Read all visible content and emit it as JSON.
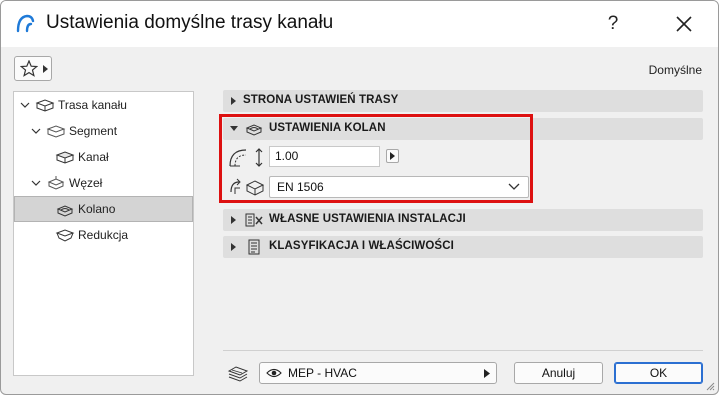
{
  "window": {
    "title": "Ustawienia domyślne trasy kanału",
    "help_label": "?"
  },
  "toolbar": {
    "preset_label": "Domyślne"
  },
  "tree": {
    "items": [
      {
        "label": "Trasa kanału",
        "icon": "duct-route-icon"
      },
      {
        "label": "Segment",
        "icon": "segment-icon"
      },
      {
        "label": "Kanał",
        "icon": "duct-icon"
      },
      {
        "label": "Węzeł",
        "icon": "node-icon"
      },
      {
        "label": "Kolano",
        "icon": "elbow-icon",
        "selected": true
      },
      {
        "label": "Redukcja",
        "icon": "reducer-icon"
      }
    ]
  },
  "panels": {
    "route_settings": {
      "label": "STRONA USTAWIEŃ TRASY",
      "expanded": false
    },
    "elbow_settings": {
      "label": "USTAWIENIA KOLAN",
      "expanded": true,
      "radius_value": "1.00",
      "standard_value": "EN 1506"
    },
    "custom_settings": {
      "label": "WŁASNE USTAWIENIA INSTALACJI",
      "expanded": false
    },
    "classification": {
      "label": "KLASYFIKACJA I WŁAŚCIWOŚCI",
      "expanded": false
    }
  },
  "footer": {
    "layer_value": "MEP - HVAC",
    "cancel_label": "Anuluj",
    "ok_label": "OK"
  },
  "colors": {
    "highlight": "#dd1010",
    "accent": "#2b6fd1",
    "header_bg": "#dedede"
  }
}
